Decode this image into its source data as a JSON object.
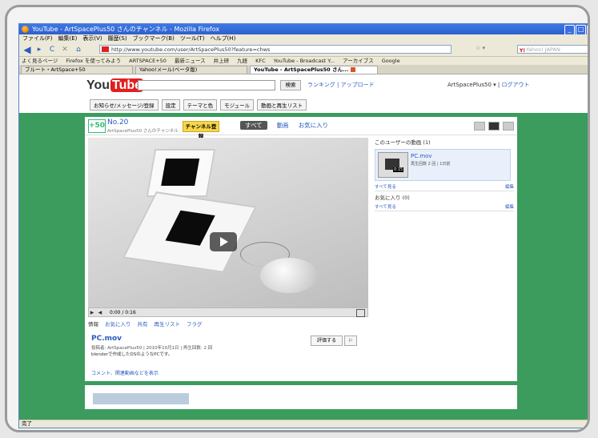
{
  "browser": {
    "title": "YouTube - ArtSpacePlus50 さんのチャンネル - Mozilla Firefox",
    "menu": [
      "ファイル(F)",
      "編集(E)",
      "表示(V)",
      "履歴(S)",
      "ブックマーク(B)",
      "ツール(T)",
      "ヘルプ(H)"
    ],
    "url": "http://www.youtube.com/user/ArtSpacePlus50?feature=chws",
    "search_engine": "Y!",
    "search_placeholder": "Yahoo! JAPAN",
    "bookmarks": [
      "よく見るページ",
      "Firefox を使ってみよう",
      "ARTSPACE+50",
      "最新ニュース",
      "井上研",
      "九経",
      "KFC",
      "YouTube - Broadcast Y...",
      "アーカイブス",
      "Google"
    ],
    "tabs": [
      {
        "label": "ブルート・ArtSpace+50"
      },
      {
        "label": "Yahoo!メール(ベータ版)"
      },
      {
        "label": "YouTube - ArtSpacePlus50 さん..."
      }
    ],
    "status": "完了"
  },
  "youtube": {
    "logo_you": "You",
    "logo_tube": "Tube",
    "search_button": "検索",
    "links": "ランキング | アップロード",
    "user": "ArtSpacePlus50 ▾",
    "logout": "ログアウト",
    "nav": [
      "お知らせ/メッセージ/登録",
      "設定",
      "テーマと色",
      "モジュール",
      "動画と再生リスト"
    ]
  },
  "channel": {
    "logo": "+50",
    "name": "No.20",
    "sub": "ArtSpacePlus50 さんのチャンネル",
    "subscribe": "チャンネル登録",
    "tabs": [
      "すべて",
      "動画",
      "お気に入り"
    ],
    "player_time": "0:00 / 0:16",
    "actions": [
      "情報",
      "お気に入り",
      "共有",
      "再生リスト",
      "フラグ"
    ],
    "video_title": "PC.mov",
    "video_meta": "投稿者: ArtSpacePlus50 | 2010年10月1日 | 再生回数: 2 回",
    "video_desc": "blenderで作成したDSのようなPCです。",
    "more": "コメント、関連動画などを表示",
    "rate": "評価する",
    "flag": "⚐"
  },
  "sidebar": {
    "uploads_header": "このユーザーの動画 (1)",
    "video_title": "PC.mov",
    "video_sub": "再生回数 2 回 | 1日前",
    "duration": "0:15",
    "see_all": "すべて見る",
    "edit": "編集",
    "favorites_header": "お気に入り (0)",
    "see_all2": "すべて見る",
    "edit2": "編集"
  }
}
